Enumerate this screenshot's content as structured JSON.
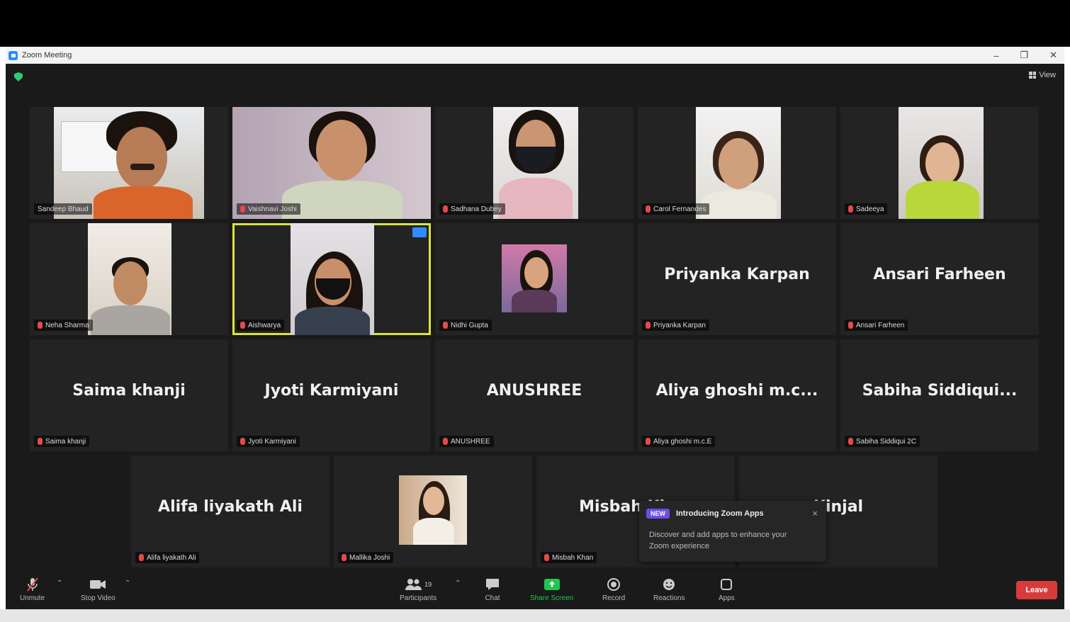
{
  "window": {
    "title": "Zoom Meeting",
    "minimize": "–",
    "maximize": "❐",
    "close": "✕"
  },
  "view_label": "View",
  "tiles": [
    {
      "name": "Sandeep Bhaud",
      "video": true
    },
    {
      "name": "Vaishnavi Joshi",
      "video": true
    },
    {
      "name": "Sadhana Dubey",
      "video": true
    },
    {
      "name": "Carol Fernandes",
      "video": true
    },
    {
      "name": "Sadeeya",
      "video": true
    },
    {
      "name": "Neha Sharma",
      "video": true
    },
    {
      "name": "Aishwarya",
      "video": true,
      "active": true
    },
    {
      "name": "Nidhi Gupta",
      "video": true
    },
    {
      "name": "Priyanka Karpan",
      "display": "Priyanka Karpan"
    },
    {
      "name": "Ansari Farheen",
      "display": "Ansari Farheen"
    },
    {
      "name": "Saima khanji",
      "display": "Saima khanji"
    },
    {
      "name": "Jyoti Karmiyani",
      "display": "Jyoti Karmiyani"
    },
    {
      "name": "ANUSHREE",
      "display": "ANUSHREE"
    },
    {
      "name": "Aliya ghoshi m.c.E",
      "display": "Aliya ghoshi m.c..."
    },
    {
      "name": "Sabiha Siddiqui 2C",
      "display": "Sabiha  Siddiqui..."
    },
    {
      "name": "Alifa liyakath Ali",
      "display": "Alifa liyakath Ali"
    },
    {
      "name": "Mallika Joshi",
      "video": true
    },
    {
      "name": "Misbah Khan",
      "display": "Misbah Khan"
    },
    {
      "name": "Kinjal",
      "display": "Kinjal"
    }
  ],
  "popup": {
    "badge": "NEW",
    "title": "Introducing Zoom Apps",
    "close": "×",
    "body": "Discover and add apps to enhance your Zoom experience"
  },
  "toolbar": {
    "unmute": "Unmute",
    "stop_video": "Stop Video",
    "participants": "Participants",
    "participants_count": "19",
    "chat": "Chat",
    "share_screen": "Share Screen",
    "record": "Record",
    "reactions": "Reactions",
    "apps": "Apps",
    "leave": "Leave"
  },
  "colors": {
    "meeting_bg": "#1a1a1a",
    "tile_bg": "#232323",
    "active_border": "#d9e43a",
    "share_green": "#23c552",
    "leave_red": "#d93b3b",
    "muted_red": "#e5484d"
  }
}
